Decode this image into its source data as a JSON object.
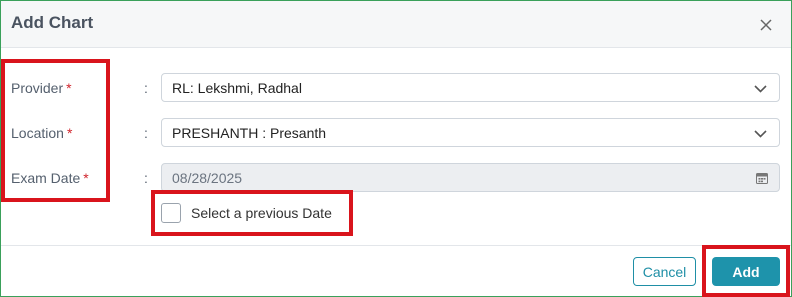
{
  "dialog": {
    "title": "Add Chart",
    "close_icon": "close-icon"
  },
  "form": {
    "provider": {
      "label": "Provider",
      "required_mark": "*",
      "colon": ":",
      "value": "RL: Lekshmi, Radhal"
    },
    "location": {
      "label": "Location",
      "required_mark": "*",
      "colon": ":",
      "value": "PRESHANTH : Presanth"
    },
    "exam_date": {
      "label": "Exam Date",
      "required_mark": "*",
      "colon": ":",
      "value": "08/28/2025"
    },
    "previous_date": {
      "label": "Select a previous Date",
      "checked": false
    }
  },
  "footer": {
    "cancel_label": "Cancel",
    "add_label": "Add"
  },
  "colors": {
    "accent": "#1e93ab",
    "required": "#d0242c",
    "highlight": "#d9141c",
    "dialog_border": "#3aa05a"
  }
}
